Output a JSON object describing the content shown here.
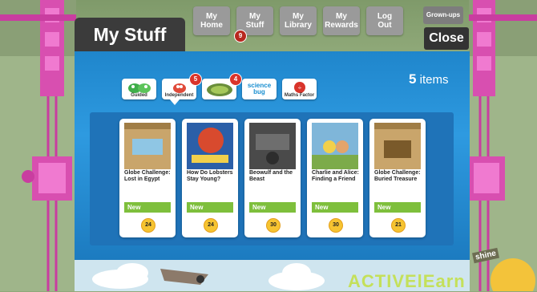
{
  "nav": {
    "tabs": [
      {
        "label": "My Home",
        "line1": "My",
        "line2": "Home"
      },
      {
        "label": "My Stuff",
        "line1": "My",
        "line2": "Stuff"
      },
      {
        "label": "My Library",
        "line1": "My",
        "line2": "Library"
      },
      {
        "label": "My Rewards",
        "line1": "My",
        "line2": "Rewards"
      },
      {
        "label": "Log Out",
        "line1": "Log",
        "line2": "Out"
      }
    ],
    "stuff_badge": "9",
    "grownups": "Grown-ups"
  },
  "page": {
    "title": "My Stuff",
    "close": "Close",
    "items_number": "5",
    "items_word": "items"
  },
  "filters": [
    {
      "label": "Guided",
      "icon": "guided-bugs-icon",
      "badge": ""
    },
    {
      "label": "Independent",
      "icon": "independent-bug-icon",
      "badge": "5"
    },
    {
      "label": "",
      "icon": "bug-club-icon",
      "badge": "4"
    },
    {
      "label": "",
      "icon": "science-bug-icon",
      "badge": "",
      "logo_text": "science bug"
    },
    {
      "label": "Maths Factor",
      "icon": "maths-factor-icon",
      "badge": ""
    }
  ],
  "books": [
    {
      "title": "Globe Challenge: Lost in Egypt",
      "status": "New",
      "points": "24",
      "cover_color": "#c9a56b"
    },
    {
      "title": "How Do Lobsters Stay Young?",
      "status": "New",
      "points": "24",
      "cover_color": "#2b5fa8"
    },
    {
      "title": "Beowulf and the Beast",
      "status": "New",
      "points": "30",
      "cover_color": "#4a4a4a"
    },
    {
      "title": "Charlie and Alice: Finding a Friend",
      "status": "New",
      "points": "30",
      "cover_color": "#7fb6d9"
    },
    {
      "title": "Globe Challenge: Buried Treasure",
      "status": "New",
      "points": "21",
      "cover_color": "#c9a56b"
    }
  ],
  "footer": {
    "brand": "ACTIVElEarn",
    "shine": "shine"
  }
}
